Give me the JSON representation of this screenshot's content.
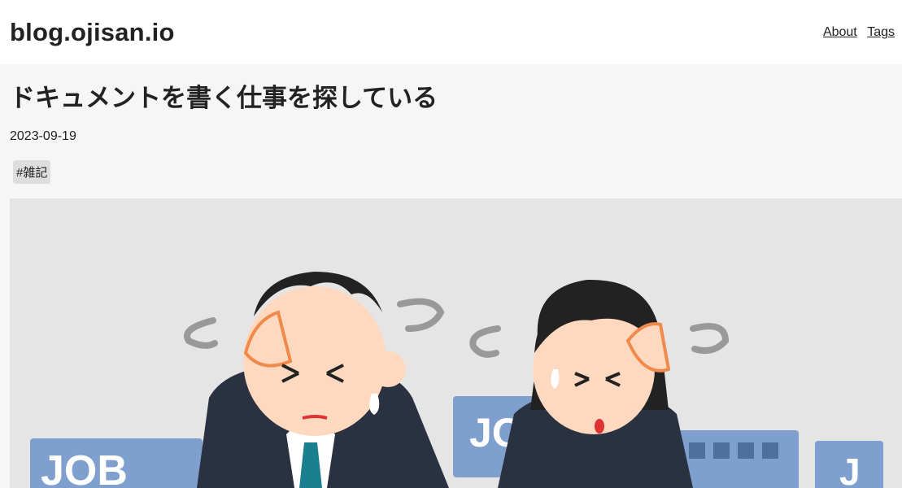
{
  "header": {
    "site_title": "blog.ojisan.io",
    "nav": [
      {
        "label": "About"
      },
      {
        "label": "Tags"
      }
    ]
  },
  "post": {
    "title": "ドキュメントを書く仕事を探している",
    "date": "2023-09-19",
    "tags": [
      "#雑記"
    ],
    "hero_image": {
      "signs": [
        "JOB",
        "JO",
        "J"
      ],
      "colors": {
        "background": "#e5e5e5",
        "suit": "#2a3140",
        "skin": "#ffd9bf",
        "hair": "#222222",
        "sign": "#7f9fcf",
        "tie": "#1a7f8f"
      }
    }
  }
}
